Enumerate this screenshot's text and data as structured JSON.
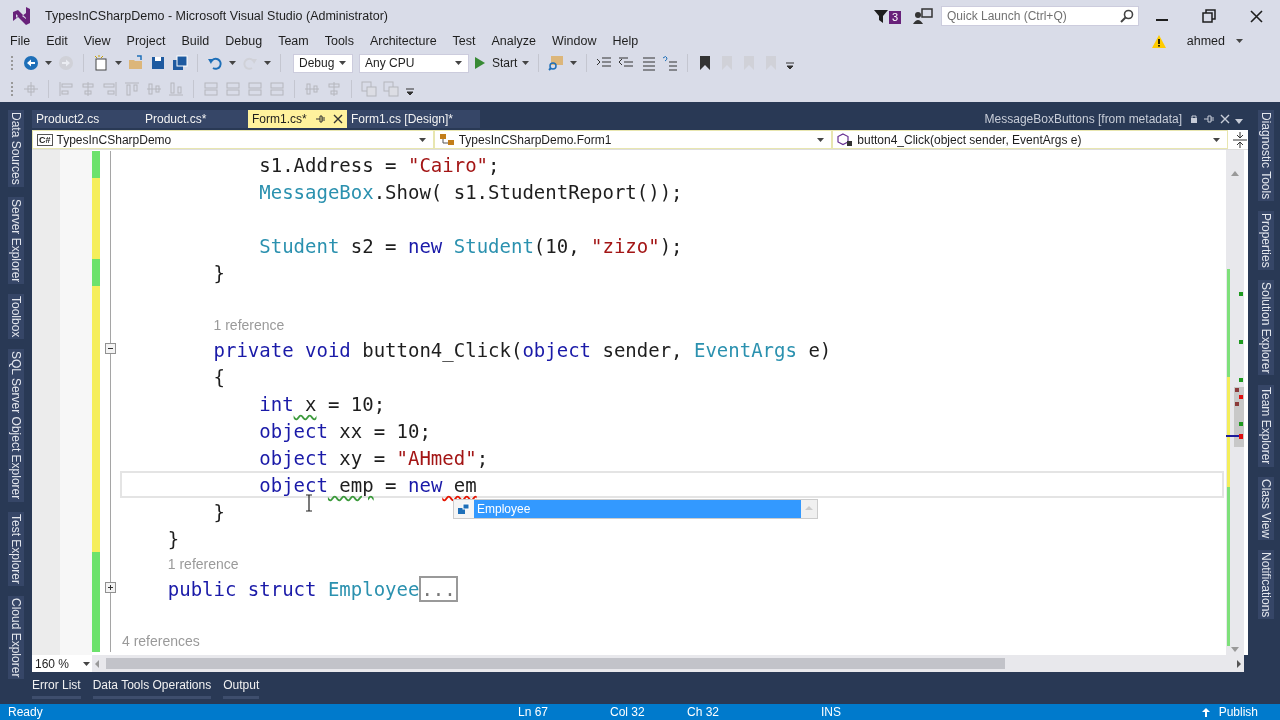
{
  "window": {
    "title": "TypesInCSharpDemo - Microsoft Visual Studio (Administrator)",
    "notification_count": "3",
    "quick_launch": {
      "placeholder": "Quick Launch (Ctrl+Q)"
    }
  },
  "menu": [
    "File",
    "Edit",
    "View",
    "Project",
    "Build",
    "Debug",
    "Team",
    "Tools",
    "Architecture",
    "Test",
    "Analyze",
    "Window",
    "Help"
  ],
  "account": {
    "user": "ahmed"
  },
  "toolbar": [
    {
      "kind": "back",
      "disabled": false,
      "menu": true
    },
    {
      "kind": "forward",
      "disabled": true,
      "menu": false
    },
    {
      "kind": "separator"
    },
    {
      "kind": "new-project",
      "disabled": false,
      "menu": true
    },
    {
      "kind": "open",
      "disabled": false,
      "menu": false
    },
    {
      "kind": "save",
      "disabled": false,
      "menu": false
    },
    {
      "kind": "save-all",
      "disabled": false,
      "menu": false
    },
    {
      "kind": "separator"
    },
    {
      "kind": "undo",
      "disabled": false,
      "menu": true
    },
    {
      "kind": "redo",
      "disabled": true,
      "menu": true
    },
    {
      "kind": "separator"
    },
    {
      "kind": "combo",
      "value": "Debug",
      "wide": false
    },
    {
      "kind": "combo",
      "value": "Any CPU",
      "wide": true
    },
    {
      "kind": "start",
      "label": "Start",
      "disabled": false,
      "menu": true
    },
    {
      "kind": "separator"
    },
    {
      "kind": "find",
      "disabled": false,
      "menu": true
    },
    {
      "kind": "separator"
    },
    {
      "kind": "indent",
      "disabled": false,
      "menu": false
    },
    {
      "kind": "outdent",
      "disabled": false,
      "menu": false
    },
    {
      "kind": "comment",
      "disabled": false,
      "menu": false
    },
    {
      "kind": "uncomment",
      "disabled": false,
      "menu": false
    },
    {
      "kind": "separator"
    },
    {
      "kind": "bookmark",
      "disabled": false,
      "menu": false
    },
    {
      "kind": "bookmark",
      "disabled": true,
      "menu": false
    },
    {
      "kind": "bookmark",
      "disabled": true,
      "menu": false
    },
    {
      "kind": "bookmark",
      "disabled": true,
      "menu": false
    },
    {
      "kind": "overflow"
    }
  ],
  "layout_toolbar": [
    {
      "kind": "align-grid",
      "disabled": true
    },
    {
      "kind": "separator"
    },
    {
      "kind": "align-left",
      "disabled": true
    },
    {
      "kind": "align-center",
      "disabled": true
    },
    {
      "kind": "align-right",
      "disabled": true
    },
    {
      "kind": "align-top",
      "disabled": true
    },
    {
      "kind": "align-middle",
      "disabled": true
    },
    {
      "kind": "align-bottom",
      "disabled": true
    },
    {
      "kind": "separator"
    },
    {
      "kind": "same-size",
      "disabled": true
    },
    {
      "kind": "same-size",
      "disabled": true
    },
    {
      "kind": "same-size",
      "disabled": true
    },
    {
      "kind": "same-size",
      "disabled": true
    },
    {
      "kind": "separator"
    },
    {
      "kind": "align-middle",
      "disabled": true
    },
    {
      "kind": "align-center",
      "disabled": true
    },
    {
      "kind": "separator"
    },
    {
      "kind": "order",
      "disabled": true
    },
    {
      "kind": "order",
      "disabled": true
    },
    {
      "kind": "overflow"
    }
  ],
  "left_panels": [
    "Data Sources",
    "Server Explorer",
    "Toolbox",
    "SQL Server Object Explorer",
    "Test Explorer",
    "Cloud Explorer"
  ],
  "right_panels": [
    "Diagnostic Tools",
    "Properties",
    "Solution Explorer",
    "Team Explorer",
    "Class View",
    "Notifications"
  ],
  "tabs": [
    {
      "label": "Product2.cs",
      "selected": false
    },
    {
      "label": "Product.cs*",
      "selected": false
    },
    {
      "label": "Form1.cs*",
      "selected": true
    },
    {
      "label": "Form1.cs [Design]*",
      "selected": false
    }
  ],
  "preview_tab": {
    "label": "MessageBoxButtons [from metadata]"
  },
  "navigation": [
    {
      "kind": "project",
      "badge": "C#",
      "value": "TypesInCSharpDemo"
    },
    {
      "kind": "class",
      "value": "TypesInCSharpDemo.Form1"
    },
    {
      "kind": "member",
      "value": "button4_Click(object sender, EventArgs e)"
    }
  ],
  "editor": {
    "lines": [
      {
        "saved": true,
        "tokens": [
          {
            "text": "            s1.Address = ",
            "kind": "plain"
          },
          {
            "text": "\"Cairo\"",
            "kind": "string"
          },
          {
            "text": ";",
            "kind": "plain"
          }
        ]
      },
      {
        "saved": false,
        "tokens": [
          {
            "text": "            MessageBox",
            "kind": "type"
          },
          {
            "text": ".Show( s1.StudentReport());",
            "kind": "plain"
          }
        ]
      },
      {
        "saved": false
      },
      {
        "saved": false,
        "tokens": [
          {
            "text": "            Student",
            "kind": "type"
          },
          {
            "text": " s2 = ",
            "kind": "plain"
          },
          {
            "text": "new",
            "kind": "keyword"
          },
          {
            "text": " Student",
            "kind": "type"
          },
          {
            "text": "(10, ",
            "kind": "plain"
          },
          {
            "text": "\"zizo\"",
            "kind": "string"
          },
          {
            "text": ");",
            "kind": "plain"
          }
        ]
      },
      {
        "saved": true,
        "tokens": [
          {
            "text": "        }",
            "kind": "plain"
          }
        ]
      },
      {
        "saved": false
      },
      {
        "saved": false,
        "lens": "1 reference"
      },
      {
        "saved": false,
        "expanded": true,
        "tokens": [
          {
            "text": "        private",
            "kind": "keyword"
          },
          {
            "text": " void",
            "kind": "keyword"
          },
          {
            "text": " button4_Click(",
            "kind": "plain"
          },
          {
            "text": "object",
            "kind": "keyword"
          },
          {
            "text": " sender, ",
            "kind": "plain"
          },
          {
            "text": "EventArgs",
            "kind": "type"
          },
          {
            "text": " e)",
            "kind": "plain"
          }
        ]
      },
      {
        "saved": false,
        "tokens": [
          {
            "text": "        {",
            "kind": "plain"
          }
        ]
      },
      {
        "saved": false,
        "tokens": [
          {
            "text": "            int",
            "kind": "keyword"
          },
          {
            "text": " x",
            "kind": "plain",
            "warning": true
          },
          {
            "text": " = 10;",
            "kind": "plain"
          }
        ]
      },
      {
        "saved": false,
        "tokens": [
          {
            "text": "            object",
            "kind": "keyword"
          },
          {
            "text": " xx = 10;",
            "kind": "plain"
          }
        ]
      },
      {
        "saved": false,
        "tokens": [
          {
            "text": "            object",
            "kind": "keyword"
          },
          {
            "text": " xy = ",
            "kind": "plain"
          },
          {
            "text": "\"AHmed\"",
            "kind": "string"
          },
          {
            "text": ";",
            "kind": "plain"
          }
        ]
      },
      {
        "saved": false,
        "current": true,
        "tokens": [
          {
            "text": "            object",
            "kind": "keyword"
          },
          {
            "text": " emp",
            "kind": "plain",
            "warning": true
          },
          {
            "text": " = ",
            "kind": "plain"
          },
          {
            "text": "new",
            "kind": "keyword"
          },
          {
            "text": " em",
            "kind": "plain",
            "error": true
          }
        ]
      },
      {
        "saved": false,
        "tokens": [
          {
            "text": "        }",
            "kind": "plain"
          }
        ]
      },
      {
        "saved": false,
        "tokens": [
          {
            "text": "    }",
            "kind": "plain"
          }
        ]
      },
      {
        "saved": true,
        "lens": "1 reference"
      },
      {
        "saved": true,
        "expanded": false,
        "tokens": [
          {
            "text": "    public",
            "kind": "keyword"
          },
          {
            "text": " struct",
            "kind": "keyword"
          },
          {
            "text": " Employee",
            "kind": "type"
          },
          {
            "text": "...",
            "kind": "collapsed"
          }
        ]
      },
      {
        "saved": true
      },
      {
        "saved": true,
        "lens": "4 references"
      }
    ],
    "completion": [
      {
        "label": "Employee",
        "selected": true
      }
    ],
    "zoom": "160 %"
  },
  "bottom_tabs": [
    "Error List",
    "Data Tools Operations",
    "Output"
  ],
  "status_bar": {
    "message": "Ready",
    "line": "Ln 67",
    "column": "Col 32",
    "char": "Ch 32",
    "mode": "INS",
    "publish": "Publish"
  }
}
